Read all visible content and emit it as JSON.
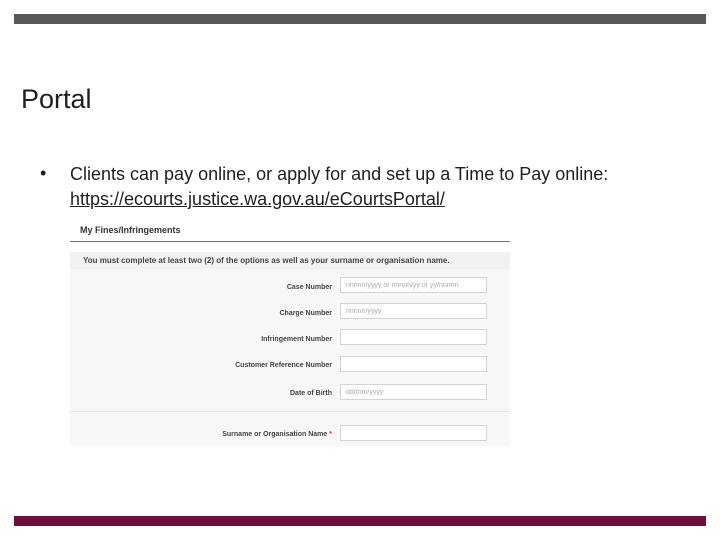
{
  "slide": {
    "title": "Portal",
    "bullet_text": "Clients can pay online, or apply for and set up a Time to Pay online:",
    "bullet_link": "https://ecourts.justice.wa.gov.au/eCourtsPortal/"
  },
  "form": {
    "heading": "My Fines/Infringements",
    "instructions": "You must complete at least two (2) of the options as well as your surname or organisation name.",
    "fields": [
      {
        "label": "Case Number",
        "placeholder": "nnnnn/yyyy or nnnnn/yy or yy/nnnnn",
        "required": false
      },
      {
        "label": "Charge Number",
        "placeholder": "nnnnn/yyyy",
        "required": false
      },
      {
        "label": "Infringement Number",
        "placeholder": "",
        "required": false
      },
      {
        "label": "Customer Reference Number",
        "placeholder": "",
        "required": false
      },
      {
        "label": "Date of Birth",
        "placeholder": "dd/mm/yyyy",
        "required": false
      },
      {
        "label": "Surname or Organisation Name",
        "placeholder": "",
        "required": true,
        "required_mark": "*"
      }
    ]
  },
  "colors": {
    "top_bar": "#595959",
    "bottom_bar": "#6d0f3a",
    "heading_rule": "#4a7db5"
  }
}
